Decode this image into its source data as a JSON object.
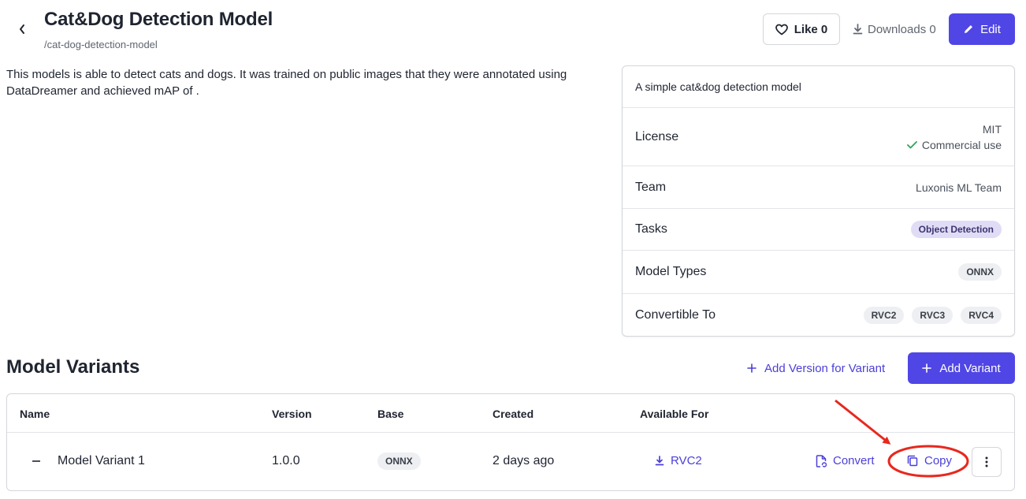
{
  "header": {
    "title": "Cat&Dog Detection Model",
    "slug": "/cat-dog-detection-model",
    "like_label": "Like 0",
    "downloads_label": "Downloads 0",
    "edit_label": "Edit"
  },
  "description": "This models is able to detect cats and dogs. It was trained on public images that they were annotated using DataDreamer and achieved mAP of .",
  "info": {
    "summary": "A simple cat&dog detection model",
    "license_label": "License",
    "license_value": "MIT",
    "commercial_use": "Commercial use",
    "team_label": "Team",
    "team_value": "Luxonis ML Team",
    "tasks_label": "Tasks",
    "tasks": [
      "Object Detection"
    ],
    "model_types_label": "Model Types",
    "model_types": [
      "ONNX"
    ],
    "convertible_label": "Convertible To",
    "convertible": [
      "RVC2",
      "RVC3",
      "RVC4"
    ]
  },
  "variants": {
    "title": "Model Variants",
    "add_version_label": "Add Version for Variant",
    "add_variant_label": "Add Variant",
    "columns": [
      "Name",
      "Version",
      "Base",
      "Created",
      "Available For"
    ],
    "rows": [
      {
        "name": "Model Variant 1",
        "version": "1.0.0",
        "base": "ONNX",
        "created": "2 days ago",
        "available_for": "RVC2",
        "convert_label": "Convert",
        "copy_label": "Copy"
      }
    ]
  },
  "colors": {
    "accent": "#5046e5",
    "annotation": "#e8281e"
  }
}
